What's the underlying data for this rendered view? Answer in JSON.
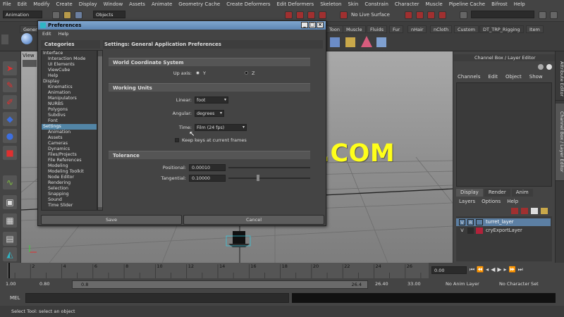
{
  "menubar": [
    "File",
    "Edit",
    "Modify",
    "Create",
    "Display",
    "Window",
    "Assets",
    "Animate",
    "Geometry Cache",
    "Create Deformers",
    "Edit Deformers",
    "Skeleton",
    "Skin",
    "Constrain",
    "Character",
    "Muscle",
    "Pipeline Cache",
    "Bifrost",
    "Help"
  ],
  "statusline": {
    "mode": "Animation",
    "selection_mode": "Objects",
    "live_surface": "No Live Surface"
  },
  "shelf_tabs": [
    "Genera",
    "Toon",
    "Muscle",
    "Fluids",
    "Fur",
    "nHair",
    "nCloth",
    "Custom",
    "DT_TRP_Rigging",
    "Item"
  ],
  "viewport_menu": "View",
  "channel_box": {
    "title": "Channel Box / Layer Editor",
    "menus": [
      "Channels",
      "Edit",
      "Object",
      "Show"
    ]
  },
  "layer_editor": {
    "tabs": [
      "Display",
      "Render",
      "Anim"
    ],
    "menus": [
      "Layers",
      "Options",
      "Help"
    ],
    "layers": [
      {
        "v": "V",
        "r": "R",
        "name": "turret_layer",
        "color": "#5c7fa3"
      },
      {
        "v": "V",
        "r": "",
        "name": "cryExportLayer",
        "color": "#b2223a"
      }
    ]
  },
  "side_tabs": [
    "Attribute Editor",
    "Channel Box / Layer Editor"
  ],
  "timeline": {
    "ticks": [
      "2",
      "4",
      "6",
      "8",
      "10",
      "12",
      "14",
      "16",
      "18",
      "20",
      "22",
      "24",
      "26"
    ],
    "current_frame": "0.00"
  },
  "range": {
    "start": "1.00",
    "inner_start": "0.80",
    "slider_value": "0.8",
    "slider_end": "26.4",
    "inner_end": "26.40",
    "end": "33.00",
    "anim_layer": "No Anim Layer",
    "char_set": "No Character Set"
  },
  "cmdline": {
    "label": "MEL"
  },
  "helpline": "Select Tool: select an object",
  "watermark": "WWW.CGTSJ.COM",
  "prefs": {
    "title": "Preferences",
    "menus": [
      "Edit",
      "Help"
    ],
    "categories_title": "Categories",
    "settings_title": "Settings: General Application Preferences",
    "categories": [
      {
        "label": "Interface",
        "level": 0
      },
      {
        "label": "Interaction Mode",
        "level": 1
      },
      {
        "label": "UI Elements",
        "level": 1
      },
      {
        "label": "ViewCube",
        "level": 1
      },
      {
        "label": "Help",
        "level": 1
      },
      {
        "label": "Display",
        "level": 0
      },
      {
        "label": "Kinematics",
        "level": 1
      },
      {
        "label": "Animation",
        "level": 1
      },
      {
        "label": "Manipulators",
        "level": 1
      },
      {
        "label": "NURBS",
        "level": 1
      },
      {
        "label": "Polygons",
        "level": 1
      },
      {
        "label": "Subdivs",
        "level": 1
      },
      {
        "label": "Font",
        "level": 1
      },
      {
        "label": "Settings",
        "level": 0,
        "selected": true
      },
      {
        "label": "Animation",
        "level": 1
      },
      {
        "label": "Assets",
        "level": 1
      },
      {
        "label": "Cameras",
        "level": 1
      },
      {
        "label": "Dynamics",
        "level": 1
      },
      {
        "label": "Files/Projects",
        "level": 1
      },
      {
        "label": "File References",
        "level": 1
      },
      {
        "label": "Modeling",
        "level": 1
      },
      {
        "label": "Modeling Toolkit",
        "level": 1
      },
      {
        "label": "Node Editor",
        "level": 1
      },
      {
        "label": "Rendering",
        "level": 1
      },
      {
        "label": "Selection",
        "level": 1
      },
      {
        "label": "Snapping",
        "level": 1
      },
      {
        "label": "Sound",
        "level": 1
      },
      {
        "label": "Time Slider",
        "level": 1
      }
    ],
    "world": {
      "section": "World Coordinate System",
      "up_axis_label": "Up axis:",
      "y_label": "Y",
      "z_label": "Z"
    },
    "units": {
      "section": "Working Units",
      "linear_label": "Linear:",
      "linear_value": "foot",
      "angular_label": "Angular:",
      "angular_value": "degrees",
      "time_label": "Time:",
      "time_value": "Film (24 fps)",
      "keep_keys_label": "Keep keys at current frames"
    },
    "tolerance": {
      "section": "Tolerance",
      "positional_label": "Positional:",
      "positional_value": "0.00010",
      "tangential_label": "Tangential:",
      "tangential_value": "0.10000"
    },
    "save_label": "Save",
    "cancel_label": "Cancel"
  }
}
